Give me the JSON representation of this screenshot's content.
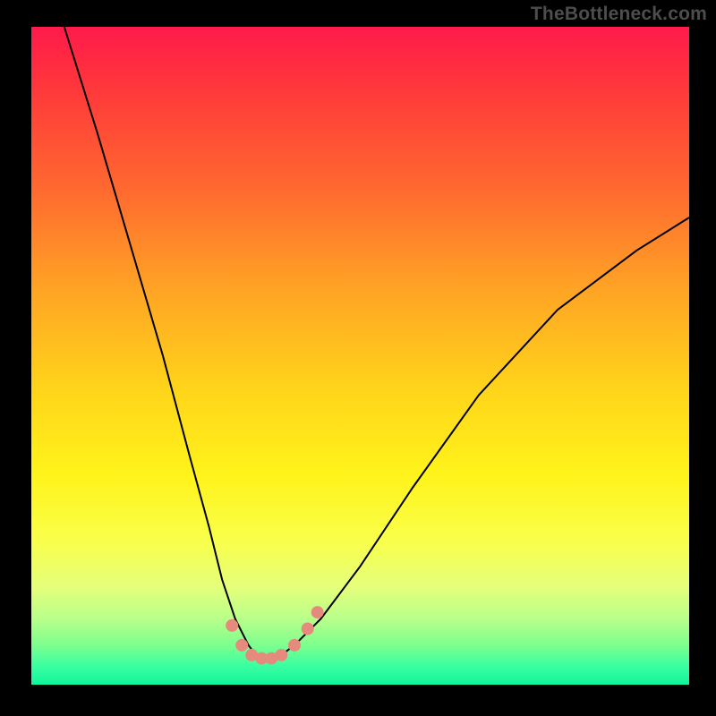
{
  "watermark": "TheBottleneck.com",
  "colors": {
    "page_bg": "#000000",
    "gradient_top": "#ff1a4b",
    "gradient_bottom": "#10f59c",
    "curve_stroke": "#000000",
    "marker_fill": "#e78a7e"
  },
  "chart_data": {
    "type": "line",
    "title": "",
    "xlabel": "",
    "ylabel": "",
    "xlim": [
      0,
      100
    ],
    "ylim": [
      0,
      100
    ],
    "grid": false,
    "legend": false,
    "notes": "Axes have no tick labels; values are percentage of plot area (0=left/bottom, 100=right/top). Curve is a V-shaped bottleneck profile.",
    "series": [
      {
        "name": "curve",
        "x": [
          5,
          10,
          15,
          20,
          24,
          27,
          29,
          31,
          33,
          34.5,
          36,
          38,
          40,
          44,
          50,
          58,
          68,
          80,
          92,
          100
        ],
        "y": [
          100,
          84,
          67,
          50,
          35,
          24,
          16,
          10,
          6,
          4,
          4,
          4.5,
          6,
          10,
          18,
          30,
          44,
          57,
          66,
          71
        ]
      }
    ],
    "markers": {
      "name": "highlighted-points",
      "x": [
        30.5,
        32,
        33.5,
        35,
        36.5,
        38,
        40,
        42,
        43.5
      ],
      "y": [
        9,
        6,
        4.5,
        4,
        4,
        4.5,
        6,
        8.5,
        11
      ]
    }
  }
}
